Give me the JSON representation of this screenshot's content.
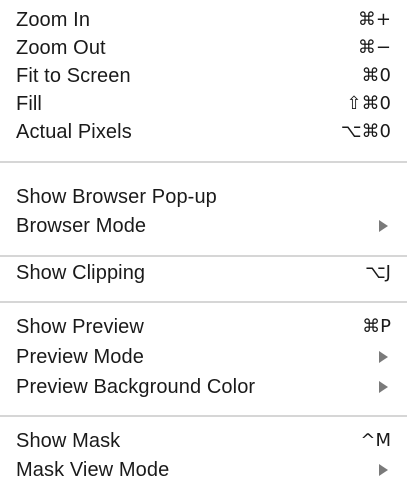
{
  "menu": {
    "items": [
      {
        "label": "Zoom In",
        "shortcut": "⌘+"
      },
      {
        "label": "Zoom Out",
        "shortcut": "⌘−"
      },
      {
        "label": "Fit to Screen",
        "shortcut": "⌘0"
      },
      {
        "label": "Fill",
        "shortcut": "⇧⌘0"
      },
      {
        "label": "Actual Pixels",
        "shortcut": "⌥⌘0"
      },
      {
        "label": "Show Browser Pop-up",
        "shortcut": ""
      },
      {
        "label": "Browser Mode",
        "submenu_icon": "submenu-arrow-icon"
      },
      {
        "label": "Show Clipping",
        "shortcut": "⌥J"
      },
      {
        "label": "Show Preview",
        "shortcut": "⌘P"
      },
      {
        "label": "Preview Mode",
        "submenu_icon": "submenu-arrow-icon"
      },
      {
        "label": "Preview Background Color",
        "submenu_icon": "submenu-arrow-icon"
      },
      {
        "label": "Show Mask",
        "shortcut": "^M"
      },
      {
        "label": "Mask View Mode",
        "submenu_icon": "submenu-arrow-icon"
      }
    ]
  },
  "colors": {
    "text": "#1a1a1a",
    "separator": "#d6d6d6",
    "submenu_arrow": "#7a7a7a",
    "background": "#ffffff"
  }
}
